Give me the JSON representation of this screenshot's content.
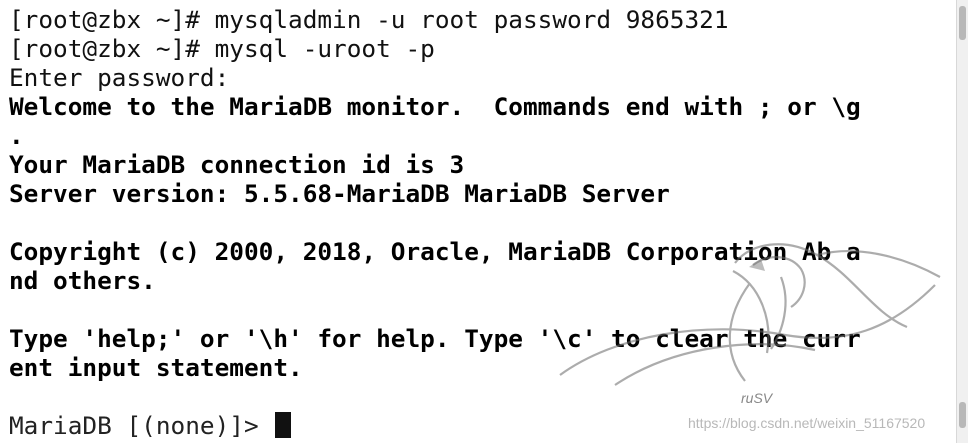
{
  "terminal": {
    "lines": [
      "[root@zbx ~]# mysqladmin -u root password 9865321",
      "[root@zbx ~]# mysql -uroot -p",
      "Enter password:",
      "Welcome to the MariaDB monitor.  Commands end with ; or \\g",
      ".",
      "Your MariaDB connection id is 3",
      "Server version: 5.5.68-MariaDB MariaDB Server",
      "",
      "Copyright (c) 2000, 2018, Oracle, MariaDB Corporation Ab a",
      "nd others.",
      "",
      "Type 'help;' or '\\h' for help. Type '\\c' to clear the curr",
      "ent input statement.",
      "",
      "MariaDB [(none)]> "
    ],
    "cursor_icon": "block-cursor"
  },
  "watermark": {
    "logo_text": "ruSV",
    "url": "https://blog.csdn.net/weixin_51167520"
  },
  "colors": {
    "background": "#ffffff",
    "text": "#111111",
    "watermark": "#b8b8b8"
  }
}
